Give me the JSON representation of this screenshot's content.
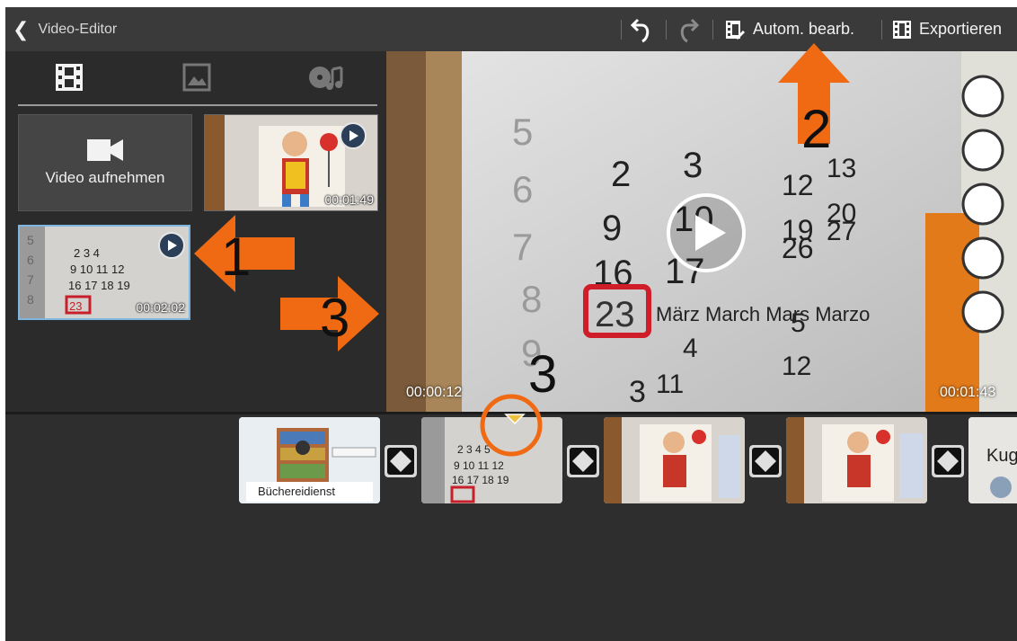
{
  "app": {
    "title": "Video-Editor"
  },
  "toolbar": {
    "auto_edit_label": "Autom. bearb.",
    "export_label": "Exportieren"
  },
  "media": {
    "tabs": [
      "video-tab",
      "image-tab",
      "audio-tab"
    ],
    "record_label": "Video aufnehmen",
    "items": [
      {
        "duration": "00:01:49"
      },
      {
        "duration": "00:02:02"
      }
    ]
  },
  "preview": {
    "current_time": "00:00:12",
    "total_time": "00:01:43"
  },
  "timeline": {
    "clips": [
      {
        "caption": "Büchereidienst"
      },
      {
        "caption": ""
      },
      {
        "caption": ""
      },
      {
        "caption": ""
      },
      {
        "caption": "Kuge"
      }
    ]
  },
  "annotations": {
    "n1": "1",
    "n2": "2",
    "n3a": "3",
    "n3b": "3",
    "color": "#ef6a12"
  }
}
